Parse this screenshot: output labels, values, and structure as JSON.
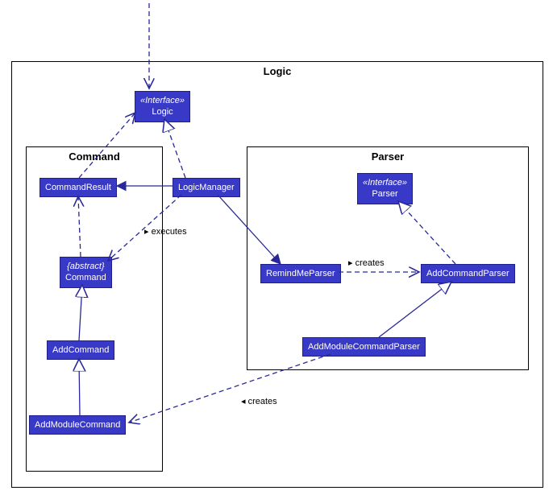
{
  "containers": {
    "logic": "Logic",
    "command": "Command",
    "parser": "Parser"
  },
  "boxes": {
    "logic_iface": {
      "stereotype": "«Interface»",
      "name": "Logic"
    },
    "logic_manager": {
      "name": "LogicManager"
    },
    "command_result": {
      "name": "CommandResult"
    },
    "command_abs": {
      "stereotype": "{abstract}",
      "name": "Command"
    },
    "add_command": {
      "name": "AddCommand"
    },
    "add_module_command": {
      "name": "AddModuleCommand"
    },
    "parser_iface": {
      "stereotype": "«Interface»",
      "name": "Parser"
    },
    "remindme_parser": {
      "name": "RemindMeParser"
    },
    "add_command_parser": {
      "name": "AddCommandParser"
    },
    "add_module_cmd_parser": {
      "name": "AddModuleCommandParser"
    }
  },
  "labels": {
    "executes": "executes",
    "creates1": "creates",
    "creates2": "creates"
  },
  "colors": {
    "box_bg": "#3939c7",
    "box_border": "#1e1e8c",
    "line": "#28289a"
  }
}
